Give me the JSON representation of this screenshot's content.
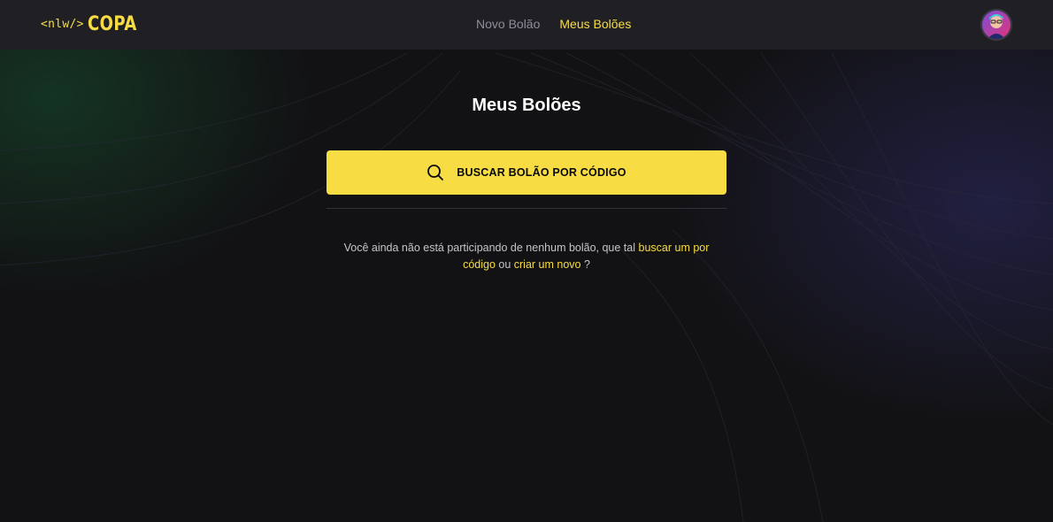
{
  "header": {
    "logo_tag": "<nlw/>",
    "logo_word": "COPA",
    "nav": [
      {
        "label": "Novo Bolão",
        "active": false
      },
      {
        "label": "Meus Bolões",
        "active": true
      }
    ],
    "avatar_icon": "user-avatar-icon"
  },
  "main": {
    "title": "Meus Bolões",
    "search_button": {
      "label": "BUSCAR BOLÃO POR CÓDIGO",
      "icon": "search-icon"
    },
    "empty_message": {
      "text_before": "Você ainda não está participando de nenhum bolão, que tal ",
      "link_search": "buscar um por código",
      "text_middle": " ou ",
      "link_create": "criar um novo",
      "text_after": " ?"
    }
  },
  "colors": {
    "accent": "#F7DD43",
    "header_bg": "#202024",
    "page_bg": "#121214",
    "muted_text": "#8D8D99",
    "body_text": "#C4C4CC"
  }
}
